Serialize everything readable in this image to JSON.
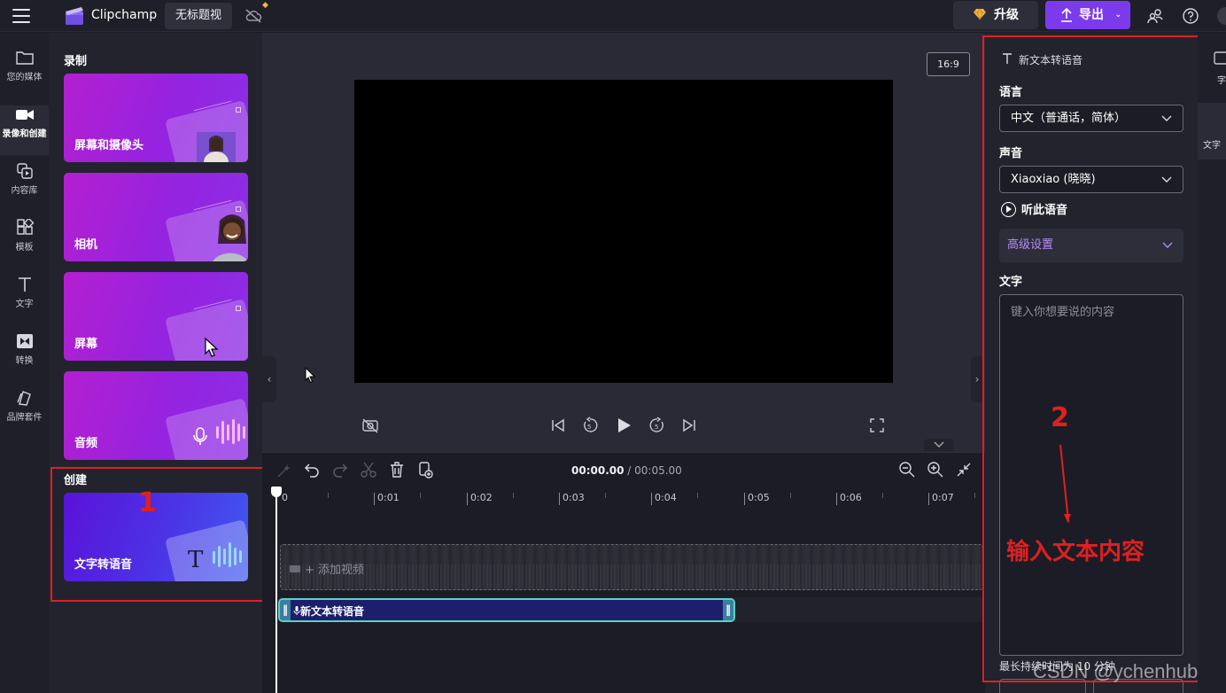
{
  "app": {
    "name": "Clipchamp",
    "project_title": "无标题视"
  },
  "header": {
    "upgrade_label": "升级",
    "export_label": "导出"
  },
  "leftnav": {
    "items": [
      {
        "label": "您的媒体",
        "icon": "folder-icon"
      },
      {
        "label": "录像和创建",
        "icon": "video-camera-icon",
        "active": true
      },
      {
        "label": "内容库",
        "icon": "library-icon"
      },
      {
        "label": "模板",
        "icon": "templates-icon"
      },
      {
        "label": "文字",
        "icon": "text-icon"
      },
      {
        "label": "转换",
        "icon": "transition-icon"
      },
      {
        "label": "品牌套件",
        "icon": "brand-kit-icon"
      }
    ]
  },
  "panel": {
    "record_title": "录制",
    "record_cards": [
      {
        "label": "屏幕和摄像头"
      },
      {
        "label": "相机"
      },
      {
        "label": "屏幕"
      },
      {
        "label": "音频"
      }
    ],
    "create_title": "创建",
    "create_cards": [
      {
        "label": "文字转语音"
      }
    ]
  },
  "annotations": {
    "num1": "1",
    "num2": "2",
    "hint": "输入文本内容"
  },
  "preview": {
    "aspect_ratio": "16:9"
  },
  "timeline": {
    "current_time": "00:00.00",
    "separator": " / ",
    "duration": "00:05.00",
    "ticks": [
      "0",
      "0:01",
      "0:02",
      "0:03",
      "0:04",
      "0:05",
      "0:06",
      "0:07"
    ],
    "add_video": "+ 添加视频",
    "tts_clip_label": "新文本转语音"
  },
  "tts_panel": {
    "title": "新文本转语音",
    "language_label": "语言",
    "language_value": "中文（普通话，简体）",
    "voice_label": "声音",
    "voice_value": "Xiaoxiao (晓晓)",
    "listen_label": "听此语音",
    "advanced_label": "高级设置",
    "text_label": "文字",
    "text_placeholder": "键入你想要说的内容",
    "max_duration": "最长持续时间为 10 分钟"
  },
  "right_tabs": {
    "tab1": "字",
    "tab2": "文字"
  },
  "watermark": "CSDN @ychenhub",
  "colors": {
    "accent": "#7c3aed",
    "annotation_red": "#e02020",
    "clip_border": "#5fd1c1"
  }
}
